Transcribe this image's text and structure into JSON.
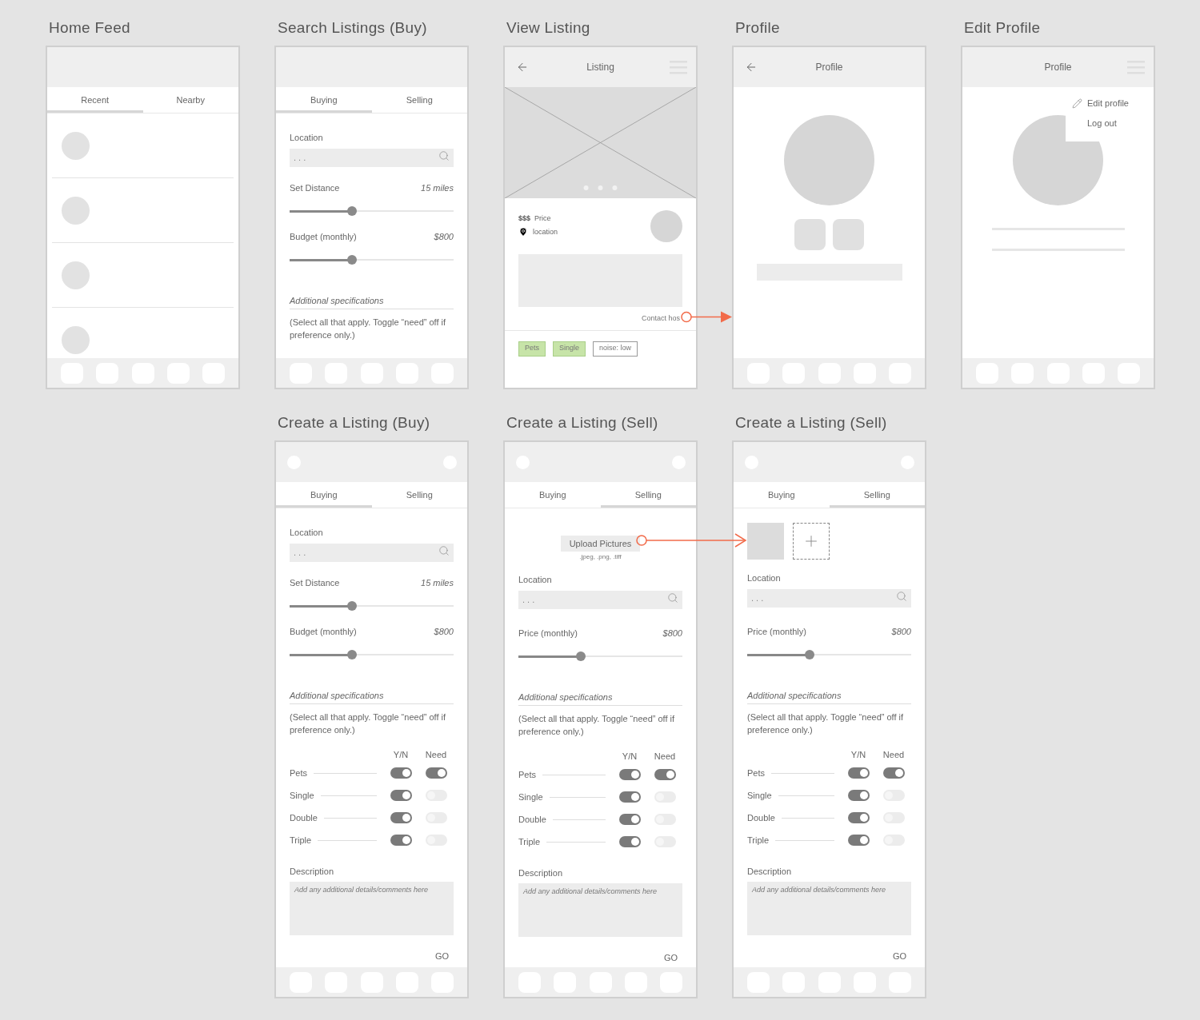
{
  "screens": [
    {
      "kind": "feed",
      "title": "Home Feed",
      "tabs": [
        {
          "label": "Recent",
          "selected": true
        },
        {
          "label": "Nearby",
          "selected": false
        }
      ]
    },
    {
      "kind": "search",
      "title": "Search Listings (Buy)",
      "tabs": [
        {
          "label": "Buying",
          "selected": true
        },
        {
          "label": "Selling",
          "selected": false
        }
      ],
      "location": {
        "label": "Location",
        "placeholder": ". . ."
      },
      "sliders": [
        {
          "label": "Set Distance",
          "reading": "15 miles",
          "level": 0.38
        },
        {
          "label": "Budget (monthly)",
          "reading": "$800",
          "level": 0.38
        }
      ],
      "specs": {
        "heading": "Additional specifications",
        "note": "(Select all that apply. Toggle “need” off if preference only.)"
      }
    },
    {
      "kind": "listing",
      "title": "View Listing",
      "header": {
        "title": "Listing",
        "back": true,
        "menu": true
      },
      "price_symbol": "$$$",
      "price": "Price",
      "location": "location",
      "contact": "Contact hos",
      "tags": [
        {
          "label": "Pets",
          "selected": true
        },
        {
          "label": "Single",
          "selected": true
        },
        {
          "label": "noise: low",
          "selected": false
        }
      ]
    },
    {
      "kind": "profile",
      "title": "Profile",
      "header": {
        "title": "Profile",
        "back": true
      }
    },
    {
      "kind": "edit_profile",
      "title": "Edit Profile",
      "header": {
        "title": "Profile",
        "menu": true
      },
      "menu_items": [
        {
          "label": "Edit profile",
          "kind": "edit"
        },
        {
          "label": "Log out",
          "kind": "plain"
        }
      ]
    },
    {
      "kind": "create",
      "title": "Create a Listing (Buy)",
      "header": {
        "corner_buttons": true
      },
      "tabs": [
        {
          "label": "Buying",
          "selected": true
        },
        {
          "label": "Selling",
          "selected": false
        }
      ],
      "location": {
        "label": "Location",
        "placeholder": ". . ."
      },
      "sliders": [
        {
          "label": "Set Distance",
          "reading": "15 miles",
          "level": 0.38
        },
        {
          "label": "Budget (monthly)",
          "reading": "$800",
          "level": 0.38
        }
      ],
      "specs": {
        "heading": "Additional specifications",
        "note": "(Select all that apply. Toggle “need” off if preference only.)"
      },
      "toggle_headers": [
        "Y/N",
        "Need"
      ],
      "toggles": [
        {
          "label": "Pets",
          "yn": true,
          "need": true
        },
        {
          "label": "Single",
          "yn": true,
          "need": false
        },
        {
          "label": "Double",
          "yn": true,
          "need": false
        },
        {
          "label": "Triple",
          "yn": true,
          "need": false
        }
      ],
      "description": {
        "label": "Description",
        "placeholder": "Add any additional details/comments here"
      },
      "submit": "GO"
    },
    {
      "kind": "create",
      "title": "Create a Listing (Sell)",
      "header": {
        "corner_buttons": true
      },
      "tabs": [
        {
          "label": "Buying",
          "selected": false
        },
        {
          "label": "Selling",
          "selected": true
        }
      ],
      "upload": {
        "label": "Upload Pictures",
        "formats": ".jpeg, .png, .tiff"
      },
      "location": {
        "label": "Location",
        "placeholder": ". . ."
      },
      "sliders": [
        {
          "label": "Price (monthly)",
          "reading": "$800",
          "level": 0.38
        }
      ],
      "specs": {
        "heading": "Additional specifications",
        "note": "(Select all that apply. Toggle “need” off if preference only.)"
      },
      "toggle_headers": [
        "Y/N",
        "Need"
      ],
      "toggles": [
        {
          "label": "Pets",
          "yn": true,
          "need": true
        },
        {
          "label": "Single",
          "yn": true,
          "need": false
        },
        {
          "label": "Double",
          "yn": true,
          "need": false
        },
        {
          "label": "Triple",
          "yn": true,
          "need": false
        }
      ],
      "description": {
        "label": "Description",
        "placeholder": "Add any additional details/comments here"
      },
      "submit": "GO"
    },
    {
      "kind": "create",
      "title": "Create a Listing (Sell)",
      "header": {
        "corner_buttons": true
      },
      "tabs": [
        {
          "label": "Buying",
          "selected": false
        },
        {
          "label": "Selling",
          "selected": true
        }
      ],
      "photos": [
        {
          "kind": "image"
        },
        {
          "kind": "add"
        }
      ],
      "location": {
        "label": "Location",
        "placeholder": ". . ."
      },
      "sliders": [
        {
          "label": "Price (monthly)",
          "reading": "$800",
          "level": 0.38
        }
      ],
      "specs": {
        "heading": "Additional specifications",
        "note": "(Select all that apply. Toggle “need” off if preference only.)"
      },
      "toggle_headers": [
        "Y/N",
        "Need"
      ],
      "toggles": [
        {
          "label": "Pets",
          "yn": true,
          "need": true
        },
        {
          "label": "Single",
          "yn": true,
          "need": false
        },
        {
          "label": "Double",
          "yn": true,
          "need": false
        },
        {
          "label": "Triple",
          "yn": true,
          "need": false
        }
      ],
      "description": {
        "label": "Description",
        "placeholder": "Add any additional details/comments here"
      },
      "submit": "GO"
    }
  ]
}
